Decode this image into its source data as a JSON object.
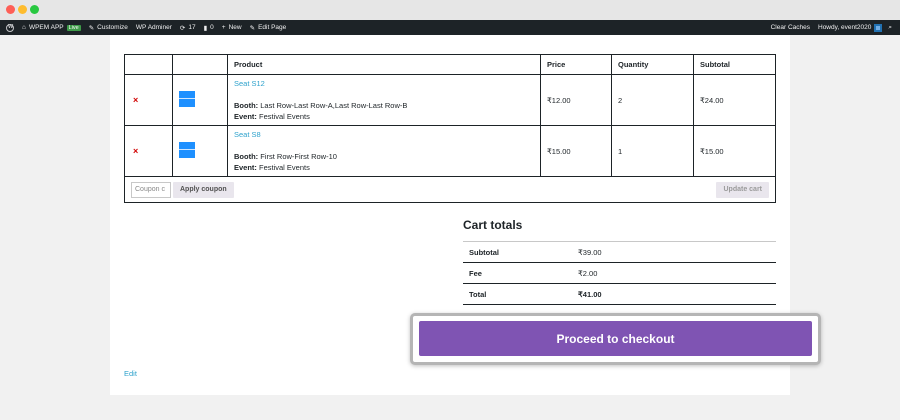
{
  "adminbar": {
    "site_name": "WPEM APP",
    "live_badge": "Live",
    "customize": "Customize",
    "wp_adminer": "WP Adminer",
    "updates_count": "17",
    "comments_count": "0",
    "new_label": "New",
    "edit_page": "Edit Page",
    "clear_caches": "Clear Caches",
    "howdy": "Howdy, event2020"
  },
  "cart": {
    "headers": {
      "product": "Product",
      "price": "Price",
      "quantity": "Quantity",
      "subtotal": "Subtotal"
    },
    "items": [
      {
        "remove": "×",
        "name": "Seat S12",
        "booth_label": "Booth:",
        "booth_value": " Last Row-Last Row-A,Last Row-Last Row-B",
        "event_label": "Event:",
        "event_value": " Festival Events",
        "price": "₹12.00",
        "quantity": "2",
        "subtotal": "₹24.00"
      },
      {
        "remove": "×",
        "name": "Seat S8",
        "booth_label": "Booth:",
        "booth_value": " First Row-First Row-10",
        "event_label": "Event:",
        "event_value": " Festival Events",
        "price": "₹15.00",
        "quantity": "1",
        "subtotal": "₹15.00"
      }
    ],
    "coupon_placeholder": "Coupon c",
    "apply_coupon": "Apply coupon",
    "update_cart": "Update cart"
  },
  "totals": {
    "title": "Cart totals",
    "subtotal_label": "Subtotal",
    "subtotal_value": "₹39.00",
    "fee_label": "Fee",
    "fee_value": "₹2.00",
    "total_label": "Total",
    "total_value": "₹41.00"
  },
  "checkout": {
    "label": "Proceed to checkout"
  },
  "footer": {
    "edit": "Edit"
  }
}
